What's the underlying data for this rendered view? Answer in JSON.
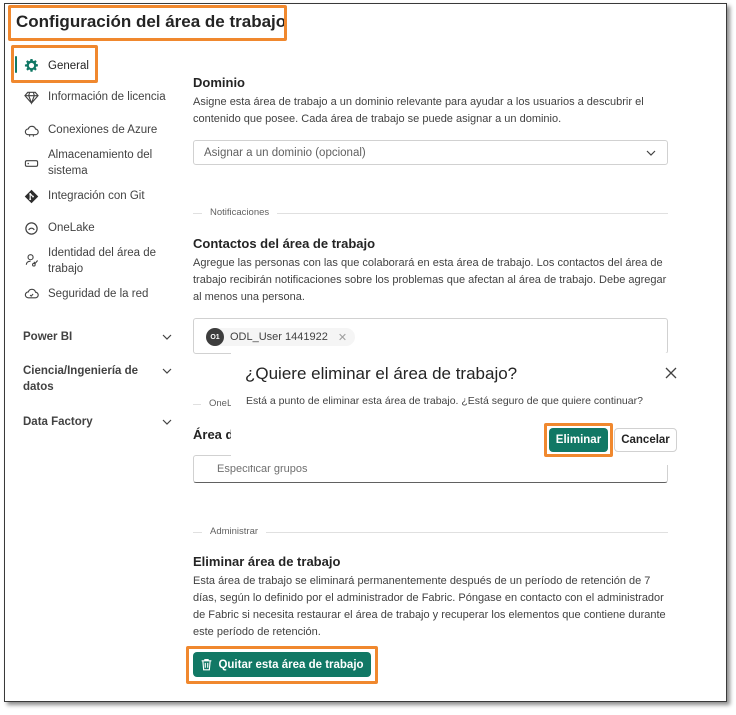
{
  "header": {
    "title": "Configuración del área de trabajo"
  },
  "sidebar": {
    "items": [
      {
        "label": "General",
        "icon": "gear-icon"
      },
      {
        "label": "Información de licencia",
        "icon": "diamond-icon"
      },
      {
        "label": "Conexiones de Azure",
        "icon": "cloud-icon"
      },
      {
        "label": "Almacenamiento del sistema",
        "icon": "storage-icon"
      },
      {
        "label": "Integración con Git",
        "icon": "git-icon"
      },
      {
        "label": "OneLake",
        "icon": "onelake-icon"
      },
      {
        "label": "Identidad del área de trabajo",
        "icon": "identity-icon"
      },
      {
        "label": "Seguridad de la red",
        "icon": "network-security-icon"
      }
    ],
    "sections": [
      {
        "label": "Power BI"
      },
      {
        "label": "Ciencia/Ingeniería de datos"
      },
      {
        "label": "Data Factory"
      }
    ]
  },
  "domain": {
    "heading": "Dominio",
    "description": "Asigne esta área de trabajo a un dominio relevante para ayudar a los usuarios a descubrir el contenido que posee. Cada área de trabajo se puede asignar a un dominio.",
    "select_placeholder": "Asignar a un dominio (opcional)"
  },
  "notifications": {
    "divider_label": "Notificaciones",
    "heading": "Contactos del área de trabajo",
    "description": "Agregue las personas con las que colaborará en esta área de trabajo. Los contactos del área de trabajo recibirán notificaciones sobre los problemas que afectan al área de trabajo. Debe agregar al menos una persona.",
    "contact": {
      "initials": "O1",
      "name": "ODL_User 1441922"
    }
  },
  "onelake": {
    "divider_label_partial": "OneL",
    "heading_partial": "Área d",
    "groups_placeholder": "Especificar grupos"
  },
  "admin": {
    "divider_label": "Administrar",
    "heading": "Eliminar área de trabajo",
    "description": "Esta área de trabajo se eliminará permanentemente después de un período de retención de 7 días, según lo definido por el administrador de Fabric. Póngase en contacto con el administrador de Fabric si necesita restaurar el área de trabajo y recuperar los elementos que contiene durante este período de retención.",
    "remove_button": "Quitar esta área de trabajo"
  },
  "dialog": {
    "title": "¿Quiere eliminar el área de trabajo?",
    "text": "Está a punto de eliminar esta área de trabajo. ¿Está seguro de que quiere continuar?",
    "confirm_label": "Eliminar",
    "cancel_label": "Cancelar"
  },
  "colors": {
    "accent": "#117865",
    "highlight": "#f0882e"
  }
}
